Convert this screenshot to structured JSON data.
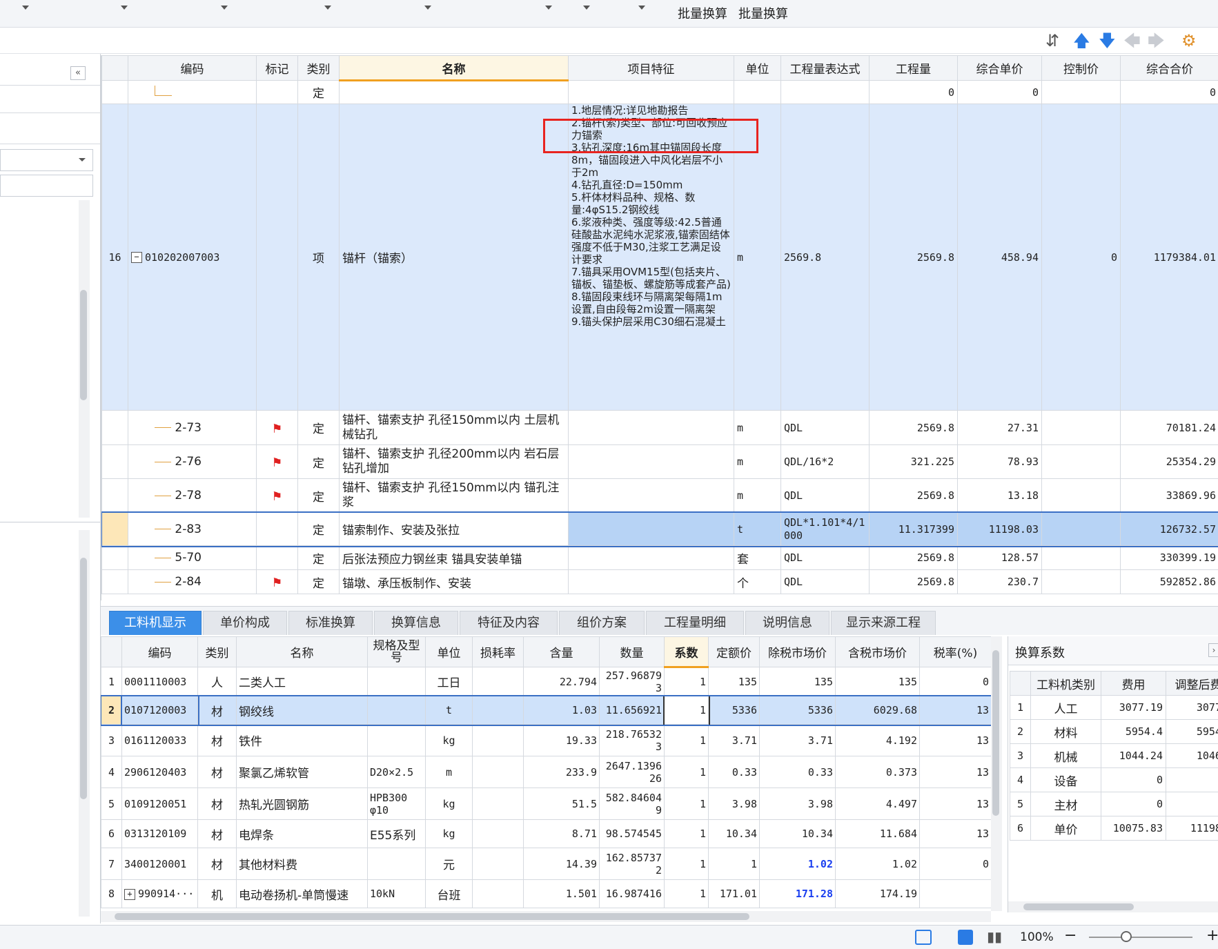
{
  "ribbon": {
    "batch1": "批量换算",
    "batch2": "批量换算"
  },
  "main": {
    "headers": [
      "编码",
      "标记",
      "类别",
      "名称",
      "项目特征",
      "单位",
      "工程量表达式",
      "工程量",
      "综合单价",
      "控制价",
      "综合合价"
    ],
    "row_top": {
      "type": "定",
      "qty": "0",
      "price": "0",
      "total": "0"
    },
    "item": {
      "no": "16",
      "code": "010202007003",
      "type": "项",
      "name": "锚杆（锚索）",
      "unit": "m",
      "expr": "2569.8",
      "qty": "2569.8",
      "price": "458.94",
      "ctrl": "0",
      "total": "1179384.01",
      "features": [
        "1.地层情况:详见地勘报告",
        "2.锚杆(索)类型、部位:可回收预应力锚索",
        "3.钻孔深度:16m其中锚固段长度8m，锚固段进入中风化岩层不小于2m",
        "4.钻孔直径:D=150mm",
        "5.杆体材料品种、规格、数量:4φS15.2钢绞线",
        "6.浆液种类、强度等级:42.5普通硅酸盐水泥纯水泥浆液,锚索固结体强度不低于M30,注浆工艺满足设计要求",
        "7.锚具采用OVM15型(包括夹片、锚板、锚垫板、螺旋筋等成套产品)",
        "8.锚固段束线环与隔离架每隔1m设置,自由段每2m设置一隔离架",
        "9.锚头保护层采用C30细石混凝土"
      ]
    },
    "subrows": [
      {
        "code": "2-73",
        "flag": true,
        "type": "定",
        "name": "锚杆、锚索支护 孔径150mm以内 土层机械钻孔",
        "unit": "m",
        "expr": "QDL",
        "qty": "2569.8",
        "price": "27.31",
        "total": "70181.24"
      },
      {
        "code": "2-76",
        "flag": true,
        "type": "定",
        "name": "锚杆、锚索支护 孔径200mm以内 岩石层钻孔增加",
        "unit": "m",
        "expr": "QDL/16*2",
        "qty": "321.225",
        "price": "78.93",
        "total": "25354.29"
      },
      {
        "code": "2-78",
        "flag": true,
        "type": "定",
        "name": "锚杆、锚索支护 孔径150mm以内 锚孔注浆",
        "unit": "m",
        "expr": "QDL",
        "qty": "2569.8",
        "price": "13.18",
        "total": "33869.96"
      },
      {
        "code": "2-83",
        "flag": false,
        "type": "定",
        "name": "锚索制作、安装及张拉",
        "unit": "t",
        "expr": "QDL*1.101*4/1000",
        "qty": "11.317399",
        "price": "11198.03",
        "total": "126732.57"
      },
      {
        "code": "5-70",
        "flag": false,
        "type": "定",
        "name": "后张法预应力钢丝束 锚具安装单锚",
        "unit": "套",
        "expr": "QDL",
        "qty": "2569.8",
        "price": "128.57",
        "total": "330399.19"
      },
      {
        "code": "2-84",
        "flag": true,
        "type": "定",
        "name": "锚墩、承压板制作、安装",
        "unit": "个",
        "expr": "QDL",
        "qty": "2569.8",
        "price": "230.7",
        "total": "592852.86"
      }
    ]
  },
  "tabs": [
    "工料机显示",
    "单价构成",
    "标准换算",
    "换算信息",
    "特征及内容",
    "组价方案",
    "工程量明细",
    "说明信息",
    "显示来源工程"
  ],
  "bottom": {
    "headers": [
      "编码",
      "类别",
      "名称",
      "规格及型号",
      "单位",
      "损耗率",
      "含量",
      "数量",
      "系数",
      "定额价",
      "除税市场价",
      "含税市场价",
      "税率(%)"
    ],
    "rows": [
      {
        "no": "1",
        "code": "0001110003",
        "type": "人",
        "name": "二类人工",
        "spec": "",
        "unit": "工日",
        "loss": "",
        "content": "22.794",
        "qty": "257.968793",
        "coef": "1",
        "quota": "135",
        "market": "135",
        "taxmarket": "135",
        "tax": "0"
      },
      {
        "no": "2",
        "code": "0107120003",
        "type": "材",
        "name": "钢绞线",
        "spec": "",
        "unit": "t",
        "loss": "",
        "content": "1.03",
        "qty": "11.656921",
        "coef": "1",
        "quota": "5336",
        "market": "5336",
        "taxmarket": "6029.68",
        "tax": "13"
      },
      {
        "no": "3",
        "code": "0161120033",
        "type": "材",
        "name": "铁件",
        "spec": "",
        "unit": "kg",
        "loss": "",
        "content": "19.33",
        "qty": "218.765323",
        "coef": "1",
        "quota": "3.71",
        "market": "3.71",
        "taxmarket": "4.192",
        "tax": "13"
      },
      {
        "no": "4",
        "code": "2906120403",
        "type": "材",
        "name": "聚氯乙烯软管",
        "spec": "D20×2.5",
        "unit": "m",
        "loss": "",
        "content": "233.9",
        "qty": "2647.139626",
        "coef": "1",
        "quota": "0.33",
        "market": "0.33",
        "taxmarket": "0.373",
        "tax": "13"
      },
      {
        "no": "5",
        "code": "0109120051",
        "type": "材",
        "name": "热轧光圆钢筋",
        "spec": "HPB300 φ10",
        "unit": "kg",
        "loss": "",
        "content": "51.5",
        "qty": "582.846049",
        "coef": "1",
        "quota": "3.98",
        "market": "3.98",
        "taxmarket": "4.497",
        "tax": "13"
      },
      {
        "no": "6",
        "code": "0313120109",
        "type": "材",
        "name": "电焊条",
        "spec": "E55系列",
        "unit": "kg",
        "loss": "",
        "content": "8.71",
        "qty": "98.574545",
        "coef": "1",
        "quota": "10.34",
        "market": "10.34",
        "taxmarket": "11.684",
        "tax": "13"
      },
      {
        "no": "7",
        "code": "3400120001",
        "type": "材",
        "name": "其他材料费",
        "spec": "",
        "unit": "元",
        "loss": "",
        "content": "14.39",
        "qty": "162.857372",
        "coef": "1",
        "quota": "1",
        "market": "1.02",
        "taxmarket": "1.02",
        "tax": "0"
      },
      {
        "no": "8",
        "code": "990914···",
        "type": "机",
        "name": "电动卷扬机-单筒慢速",
        "spec": "10kN",
        "unit": "台班",
        "loss": "",
        "content": "1.501",
        "qty": "16.987416",
        "coef": "1",
        "quota": "171.01",
        "market": "171.28",
        "taxmarket": "174.19",
        "tax": ""
      }
    ]
  },
  "coef": {
    "title": "换算系数",
    "headers": [
      "工料机类别",
      "费用",
      "调整后费"
    ],
    "rows": [
      {
        "no": "1",
        "cat": "人工",
        "fee": "3077.19",
        "adj": "3077."
      },
      {
        "no": "2",
        "cat": "材料",
        "fee": "5954.4",
        "adj": "5954."
      },
      {
        "no": "3",
        "cat": "机械",
        "fee": "1044.24",
        "adj": "1046."
      },
      {
        "no": "4",
        "cat": "设备",
        "fee": "0",
        "adj": ""
      },
      {
        "no": "5",
        "cat": "主材",
        "fee": "0",
        "adj": ""
      },
      {
        "no": "6",
        "cat": "单价",
        "fee": "10075.83",
        "adj": "11198."
      }
    ]
  },
  "status": {
    "zoom": "100%"
  }
}
